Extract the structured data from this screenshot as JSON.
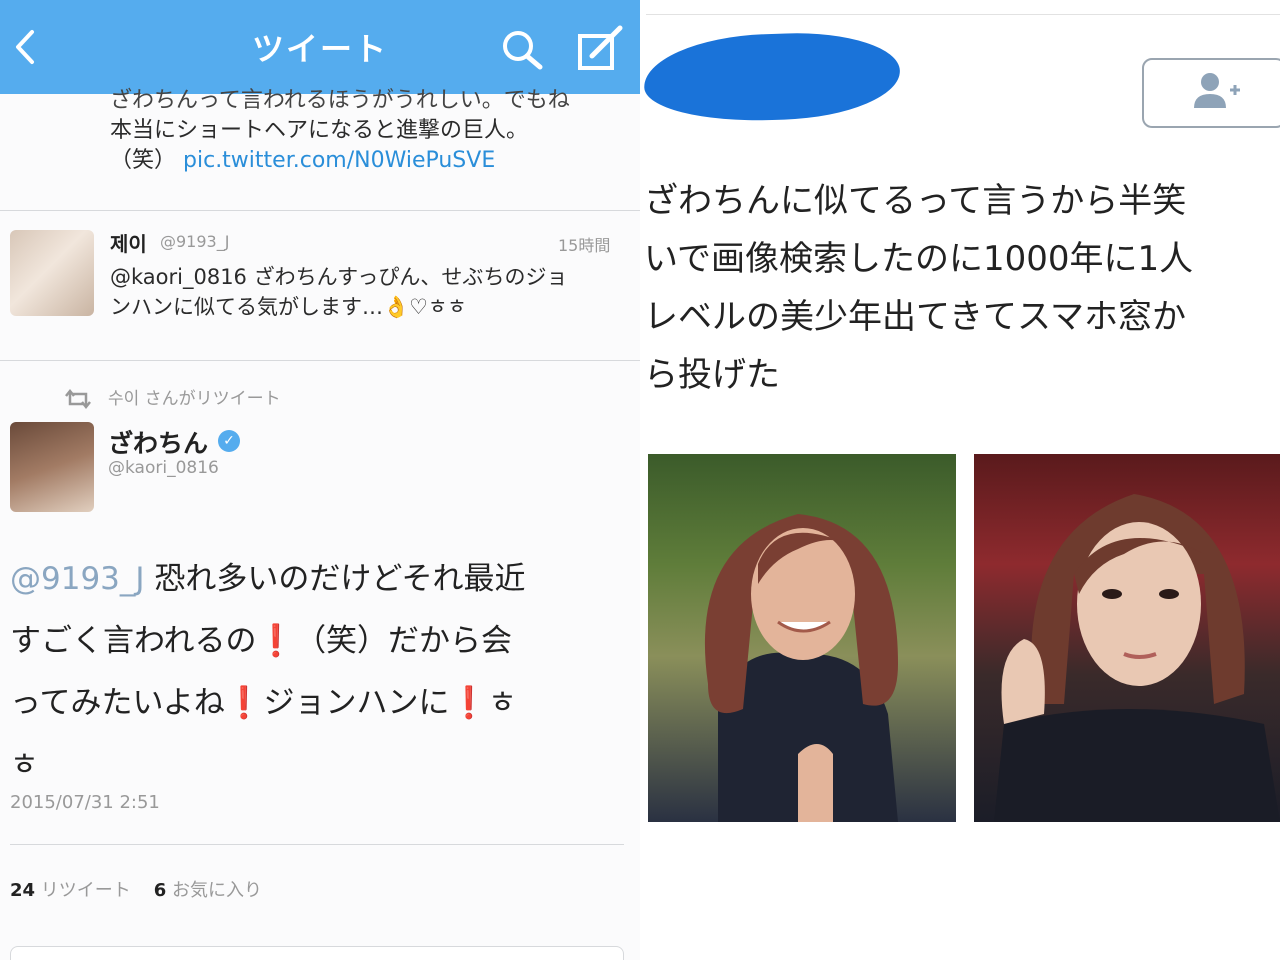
{
  "left": {
    "nav": {
      "title": "ツイート"
    },
    "quoted": {
      "line1": "ざわちんって言われるほうがうれしい。でもね",
      "line2": "本当にショートヘアになると進撃の巨人。",
      "laugh": "（笑）",
      "link": "pic.twitter.com/N0WiePuSVE"
    },
    "reply": {
      "name": "제이",
      "handle": "@9193_J",
      "time": "15時間",
      "line1": "@kaori_0816 ざわちんすっぴん、せぶちのジョ",
      "line2": "ンハンに似てる気がします…👌♡ㅎㅎ"
    },
    "retweet_line": "수이 さんがリツイート",
    "tweet": {
      "name": "ざわちん",
      "handle": "@kaori_0816",
      "mention": "@9193_J",
      "line1": " 恐れ多いのだけどそれ最近",
      "line2a": "すごく言われるの",
      "line2b": "（笑）だから会",
      "line3a": "ってみたいよね",
      "line3b": "ジョンハンに",
      "line3c": "ㅎ",
      "line4": "ㅎ",
      "excl": "❗",
      "timestamp": "2015/07/31 2:51",
      "retweets_count": "24",
      "retweets_label": "リツイート",
      "favs_count": "6",
      "favs_label": "お気に入り"
    }
  },
  "right": {
    "line1": "ざわちんに似てるって言うから半笑",
    "line2": "いで画像検索したのに1000年に1人",
    "line3": "レベルの美少年出てきてスマホ窓か",
    "line4": "ら投げた"
  },
  "colors": {
    "twitter_blue": "#55acee",
    "link_blue": "#2a8ed9",
    "mention": "#8aa6c1",
    "exclamation": "#e0182f",
    "redaction_blob": "#1a73d9"
  },
  "icons": [
    "back-chevron-icon",
    "search-icon",
    "compose-icon",
    "retweet-icon",
    "verified-badge-icon",
    "add-user-icon"
  ]
}
